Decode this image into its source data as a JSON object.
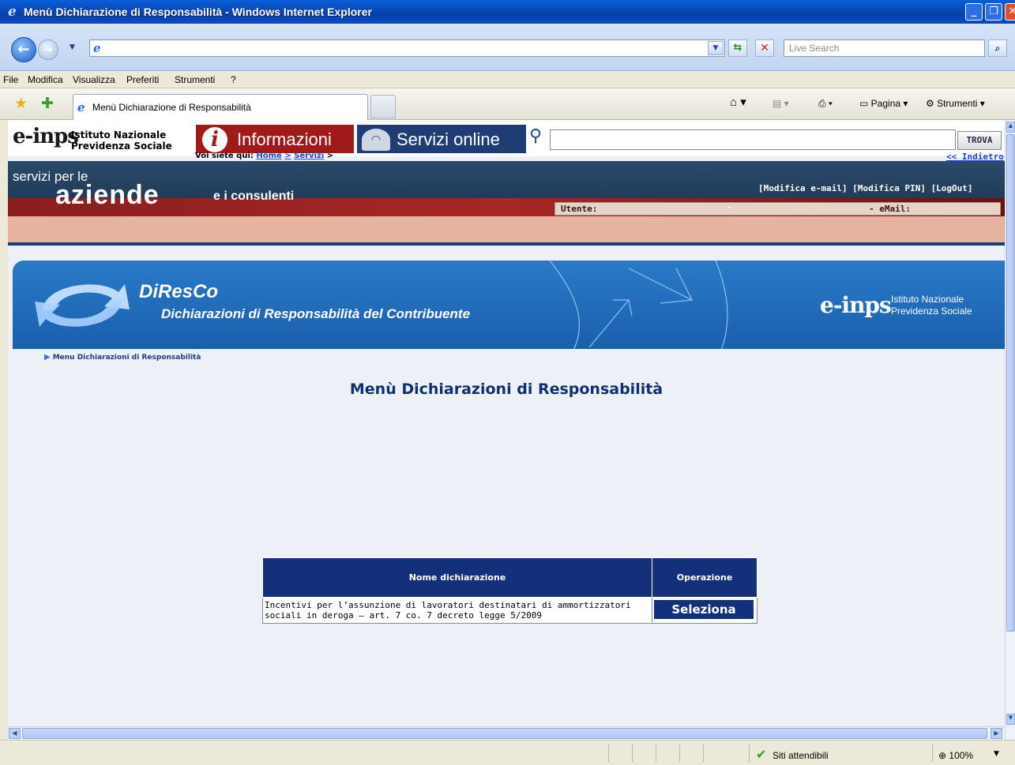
{
  "window": {
    "title": "Menù Dichiarazione di Responsabilità - Windows Internet Explorer"
  },
  "addressbar": {
    "search_placeholder": "Live Search"
  },
  "menubar": [
    "File",
    "Modifica",
    "Visualizza",
    "Preferiti",
    "Strumenti",
    "?"
  ],
  "tabbar": {
    "tab_label": "Menù Dichiarazione di Responsabilità",
    "page_menu": "Pagina",
    "tools_menu": "Strumenti"
  },
  "inps": {
    "logo": "e-inps",
    "name_line1": "Istituto Nazionale",
    "name_line2": "Previdenza Sociale",
    "tab_info": "Informazioni",
    "tab_services": "Servizi online",
    "search_button": "TROVA",
    "breadcrumb_prefix": "Voi siete qui:",
    "breadcrumb_home": "Home",
    "breadcrumb_sep1": ">",
    "breadcrumb_services": "Servizi",
    "breadcrumb_sep2": ">",
    "back_link": "<< Indietro",
    "banner_line1": "servizi per le",
    "banner_main": "aziende",
    "banner_small": "e i consulenti",
    "link_email": "[Modifica e-mail]",
    "link_pin": "[Modifica PIN]",
    "link_logout": "[LogOut]",
    "user_label": "Utente:",
    "dash": "-",
    "email_label": "- eMail:"
  },
  "diresco": {
    "title": "DiResCo",
    "subtitle": "Dichiarazioni di Responsabilità del Contribuente",
    "logo": "e-inps",
    "inst_line1": "Istituto Nazionale",
    "inst_line2": "Previdenza Sociale"
  },
  "page": {
    "breadcrumb": "Menu Dichiarazioni di Responsabilità",
    "title": "Menù Dichiarazioni di Responsabilità"
  },
  "table": {
    "headers": [
      "Nome dichiarazione",
      "Operazione"
    ],
    "rows": [
      {
        "name": "Incentivi per l’assunzione di lavoratori destinatari di ammortizzatori sociali in deroga – art. 7 co. 7 decreto legge 5/2009",
        "action": "Seleziona"
      }
    ]
  },
  "statusbar": {
    "zone": "Siti attendibili",
    "zoom": "100%"
  }
}
